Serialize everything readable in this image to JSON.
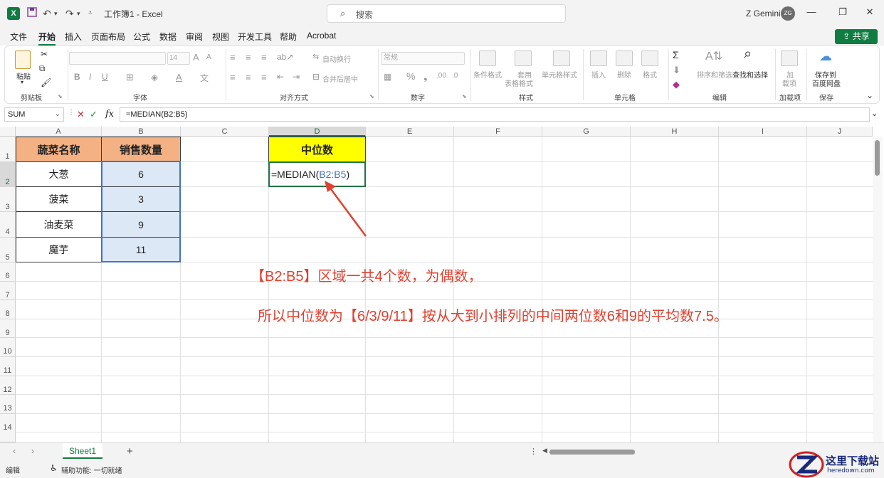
{
  "titlebar": {
    "doc_title": "工作簿1 - Excel",
    "search_placeholder": "搜索",
    "user_name": "Z Gemini",
    "avatar_initials": "ZG"
  },
  "menu": {
    "tabs": [
      "文件",
      "开始",
      "插入",
      "页面布局",
      "公式",
      "数据",
      "审阅",
      "视图",
      "开发工具",
      "帮助",
      "Acrobat"
    ],
    "active_tab": "开始",
    "share_label": "共享"
  },
  "ribbon": {
    "paste_label": "粘贴",
    "font_name": "",
    "font_size": "14",
    "wrap_text": "自动换行",
    "merge_center": "合并后居中",
    "number_format": "常规",
    "conditional_format": "条件格式",
    "table_format_1": "套用",
    "table_format_2": "表格格式",
    "cell_style": "单元格样式",
    "insert": "插入",
    "delete": "删除",
    "format": "格式",
    "sort_filter": "排序和筛选",
    "find_select": "查找和选择",
    "addin_1": "加",
    "addin_2": "载项",
    "save_baidu_1": "保存到",
    "save_baidu_2": "百度网盘",
    "groups": {
      "clipboard": "剪贴板",
      "font": "字体",
      "alignment": "对齐方式",
      "number": "数字",
      "styles": "样式",
      "cells": "单元格",
      "editing": "编辑",
      "addins": "加载项",
      "save": "保存"
    }
  },
  "formula_bar": {
    "name_box": "SUM",
    "formula": "=MEDIAN(B2:B5)"
  },
  "grid": {
    "columns": [
      "A",
      "B",
      "C",
      "D",
      "E",
      "F",
      "G",
      "H",
      "I",
      "J"
    ],
    "rows": [
      "1",
      "2",
      "3",
      "4",
      "5",
      "6",
      "7",
      "8",
      "9",
      "10",
      "11",
      "12",
      "13",
      "14"
    ],
    "A1": "蔬菜名称",
    "B1": "销售数量",
    "D1": "中位数",
    "vegetables": [
      "大葱",
      "菠菜",
      "油麦菜",
      "魔芋"
    ],
    "quantities": [
      "6",
      "3",
      "9",
      "11"
    ],
    "active_formula_prefix": "=MEDIAN(",
    "active_formula_ref": "B2:B5",
    "active_formula_suffix": ")"
  },
  "annotations": {
    "line1": "【B2:B5】区域一共4个数，为偶数，",
    "line2": "所以中位数为【6/3/9/11】按从大到小排列的中间两位数6和9的平均数7.5。",
    "color": "#e04030"
  },
  "sheets": {
    "active": "Sheet1",
    "add": "+"
  },
  "status": {
    "mode": "编辑",
    "accessibility": "辅助功能: 一切就绪"
  },
  "watermark": {
    "name": "这里下载站",
    "url": "heredown.com"
  },
  "colors": {
    "excel_green": "#107c41",
    "header_orange": "#f4b183",
    "header_yellow": "#ffff00",
    "range_blue": "#dde8f6"
  }
}
